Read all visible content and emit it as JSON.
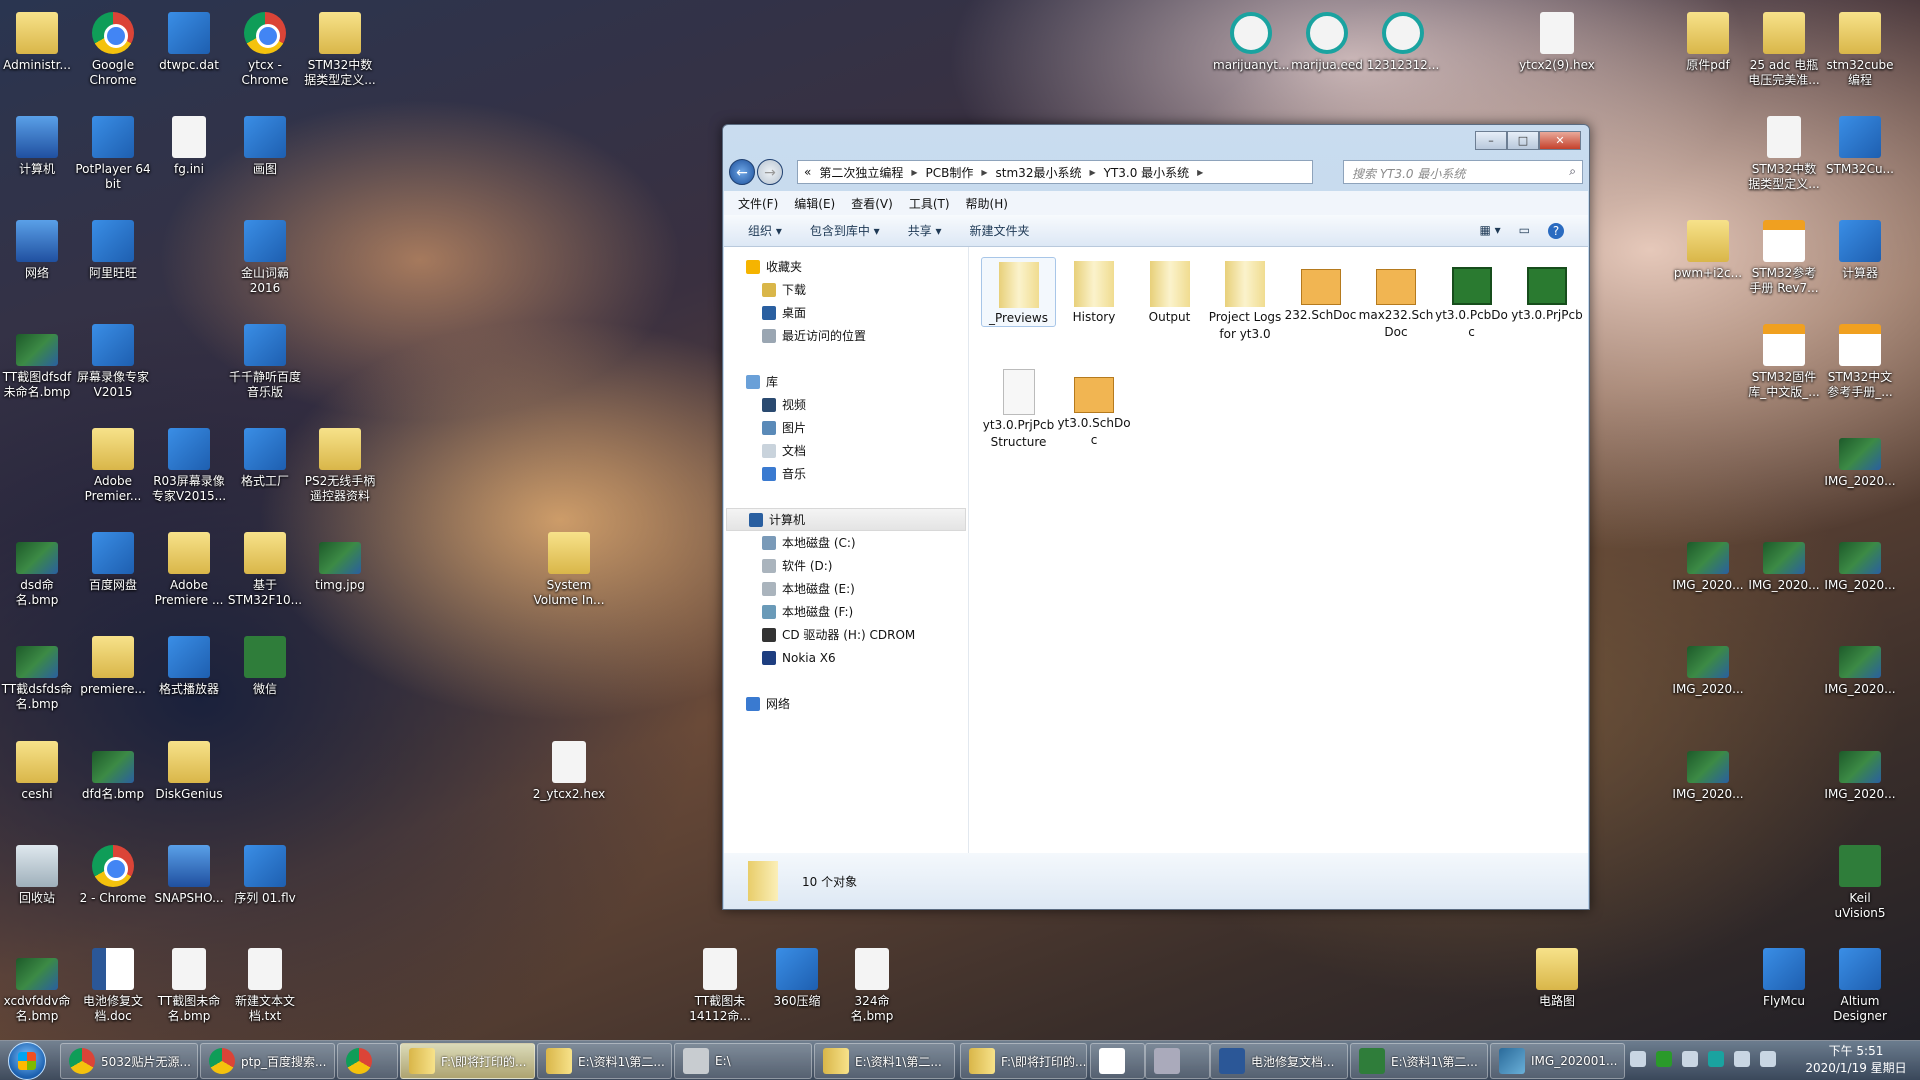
{
  "desktop": {
    "icons": [
      {
        "label": "Administr...",
        "type": "folder"
      },
      {
        "label": "Google Chrome",
        "type": "chrome"
      },
      {
        "label": "dtwpc.dat",
        "type": "app"
      },
      {
        "label": "ytcx - Chrome",
        "type": "chrome"
      },
      {
        "label": "STM32中数据类型定义...",
        "type": "folder"
      },
      {
        "label": "计算机",
        "type": "sys"
      },
      {
        "label": "PotPlayer 64 bit",
        "type": "app"
      },
      {
        "label": "fg.ini",
        "type": "file"
      },
      {
        "label": "画图",
        "type": "app"
      },
      {
        "label": "网络",
        "type": "sys"
      },
      {
        "label": "阿里旺旺",
        "type": "app"
      },
      {
        "label": "金山词霸 2016",
        "type": "app"
      },
      {
        "label": "TT截图dfsdf未命名.bmp",
        "type": "image"
      },
      {
        "label": "屏幕录像专家V2015",
        "type": "app"
      },
      {
        "label": "千千静听百度音乐版",
        "type": "app"
      },
      {
        "label": "Adobe Premier...",
        "type": "folder"
      },
      {
        "label": "R03屏幕录像专家V2015...",
        "type": "app"
      },
      {
        "label": "格式工厂",
        "type": "app"
      },
      {
        "label": "PS2无线手柄遥控器资料",
        "type": "folder"
      },
      {
        "label": "dsd命名.bmp",
        "type": "image"
      },
      {
        "label": "百度网盘",
        "type": "app"
      },
      {
        "label": "Adobe Premiere ...",
        "type": "folder"
      },
      {
        "label": "基于STM32F10...",
        "type": "folder"
      },
      {
        "label": "timg.jpg",
        "type": "image"
      },
      {
        "label": "TT截dsfds命名.bmp",
        "type": "image"
      },
      {
        "label": "premiere...",
        "type": "folder"
      },
      {
        "label": "格式播放器",
        "type": "app"
      },
      {
        "label": "微信",
        "type": "green"
      },
      {
        "label": "ceshi",
        "type": "folder"
      },
      {
        "label": "dfd名.bmp",
        "type": "image"
      },
      {
        "label": "DiskGenius",
        "type": "folder"
      },
      {
        "label": "回收站",
        "type": "bin"
      },
      {
        "label": "2 - Chrome",
        "type": "chrome"
      },
      {
        "label": "SNAPSHO...",
        "type": "sys"
      },
      {
        "label": "序列 01.flv",
        "type": "app"
      },
      {
        "label": "xcdvfddv命名.bmp",
        "type": "image"
      },
      {
        "label": "电池修复文档.doc",
        "type": "doc"
      },
      {
        "label": "TT截图未命名.bmp",
        "type": "file"
      },
      {
        "label": "新建文本文档.txt",
        "type": "file"
      },
      {
        "label": "System Volume In...",
        "type": "folder"
      },
      {
        "label": "2_ytcx2.hex",
        "type": "file"
      },
      {
        "label": "TT截图未14112命...",
        "type": "file"
      },
      {
        "label": "360压缩",
        "type": "app"
      },
      {
        "label": "324命名.bmp",
        "type": "file"
      },
      {
        "label": "电路图",
        "type": "folder"
      },
      {
        "label": "marijuanyt...",
        "type": "ese"
      },
      {
        "label": "marijua.eed",
        "type": "ese"
      },
      {
        "label": "12312312...",
        "type": "ese"
      },
      {
        "label": "ytcx2(9).hex",
        "type": "file"
      },
      {
        "label": "原件pdf",
        "type": "folder"
      },
      {
        "label": "25 adc 电瓶电压完美准...",
        "type": "folder"
      },
      {
        "label": "stm32cube编程",
        "type": "folder"
      },
      {
        "label": "STM32中数据类型定义...",
        "type": "file"
      },
      {
        "label": "STM32Cu...",
        "type": "app"
      },
      {
        "label": "pwm+i2c...",
        "type": "folder"
      },
      {
        "label": "STM32参考手册 Rev7...",
        "type": "pdf"
      },
      {
        "label": "计算器",
        "type": "app"
      },
      {
        "label": "STM32固件库_中文版_...",
        "type": "pdf"
      },
      {
        "label": "STM32中文参考手册_...",
        "type": "pdf"
      },
      {
        "label": "IMG_2020...",
        "type": "image"
      },
      {
        "label": "IMG_2020...",
        "type": "image"
      },
      {
        "label": "IMG_2020...",
        "type": "image"
      },
      {
        "label": "IMG_2020...",
        "type": "image"
      },
      {
        "label": "IMG_2020...",
        "type": "image"
      },
      {
        "label": "IMG_2020...",
        "type": "image"
      },
      {
        "label": "IMG_2020...",
        "type": "image"
      },
      {
        "label": "IMG_2020...",
        "type": "image"
      },
      {
        "label": "Keil uVision5",
        "type": "green"
      },
      {
        "label": "FlyMcu",
        "type": "app"
      },
      {
        "label": "Altium Designer",
        "type": "app"
      }
    ]
  },
  "explorer": {
    "window_controls": {
      "minimize": "–",
      "maximize": "□",
      "close": "✕"
    },
    "breadcrumb": [
      "«",
      "第二次独立编程",
      "PCB制作",
      "stm32最小系统",
      "YT3.0 最小系统"
    ],
    "search_placeholder": "搜索 YT3.0 最小系统",
    "menu": [
      "文件(F)",
      "编辑(E)",
      "查看(V)",
      "工具(T)",
      "帮助(H)"
    ],
    "commands": [
      "组织 ▾",
      "包含到库中 ▾",
      "共享 ▾",
      "新建文件夹"
    ],
    "nav": [
      {
        "label": "收藏夹",
        "level": "h",
        "color": "#f5b400"
      },
      {
        "label": "下载",
        "color": "#d9b649"
      },
      {
        "label": "桌面",
        "color": "#2a5fa0"
      },
      {
        "label": "最近访问的位置",
        "color": "#9aa6b2"
      },
      {
        "label": "",
        "gap": true
      },
      {
        "label": "库",
        "level": "h",
        "color": "#6aa0d8"
      },
      {
        "label": "视频",
        "color": "#2a4a70"
      },
      {
        "label": "图片",
        "color": "#5a8ab8"
      },
      {
        "label": "文档",
        "color": "#c9d3dc"
      },
      {
        "label": "音乐",
        "color": "#3a7ad0"
      },
      {
        "label": "",
        "gap": true
      },
      {
        "label": "计算机",
        "level": "h",
        "selected": true,
        "color": "#2a5fa0"
      },
      {
        "label": "本地磁盘 (C:)",
        "color": "#7a9ab8"
      },
      {
        "label": "软件 (D:)",
        "color": "#aab4bd"
      },
      {
        "label": "本地磁盘 (E:)",
        "color": "#aab4bd"
      },
      {
        "label": "本地磁盘 (F:)",
        "color": "#6a9ab8"
      },
      {
        "label": "CD 驱动器 (H:) CDROM",
        "color": "#333"
      },
      {
        "label": "Nokia X6",
        "color": "#1e3e80"
      },
      {
        "label": "",
        "gap": true
      },
      {
        "label": "网络",
        "level": "h",
        "color": "#3a7ad0"
      }
    ],
    "files": [
      {
        "name": "_Previews",
        "type": "folder",
        "selected": true
      },
      {
        "name": "History",
        "type": "folder"
      },
      {
        "name": "Output",
        "type": "folder"
      },
      {
        "name": "Project Logs for yt3.0",
        "type": "folder"
      },
      {
        "name": "232.SchDoc",
        "type": "sch"
      },
      {
        "name": "max232.SchDoc",
        "type": "sch"
      },
      {
        "name": "yt3.0.PcbDoc",
        "type": "pcb"
      },
      {
        "name": "yt3.0.PrjPcb",
        "type": "pcb"
      },
      {
        "name": "yt3.0.PrjPcbStructure",
        "type": "blank"
      },
      {
        "name": "yt3.0.SchDoc",
        "type": "sch"
      }
    ],
    "status": "10 个对象"
  },
  "taskbar": {
    "items": [
      {
        "label": "5032贴片无源...",
        "icon": "chrome"
      },
      {
        "label": "ptp_百度搜索...",
        "icon": "chrome"
      },
      {
        "label": "",
        "icon": "chrome"
      },
      {
        "label": "F:\\即将打印的...",
        "icon": "folder",
        "active": true
      },
      {
        "label": "E:\\资料1\\第二...",
        "icon": "folder"
      },
      {
        "label": "E:\\",
        "icon": "drive"
      },
      {
        "label": "E:\\资料1\\第二...",
        "icon": "folder"
      },
      {
        "label": "F:\\即将打印的...",
        "icon": "folder"
      },
      {
        "label": "",
        "icon": "baidu"
      },
      {
        "label": "",
        "icon": "app"
      },
      {
        "label": "电池修复文档...",
        "icon": "word"
      },
      {
        "label": "E:\\资料1\\第二...",
        "icon": "keil"
      },
      {
        "label": "IMG_202001...",
        "icon": "image"
      }
    ],
    "clock_time": "下午 5:51",
    "clock_date": "2020/1/19 星期日"
  }
}
